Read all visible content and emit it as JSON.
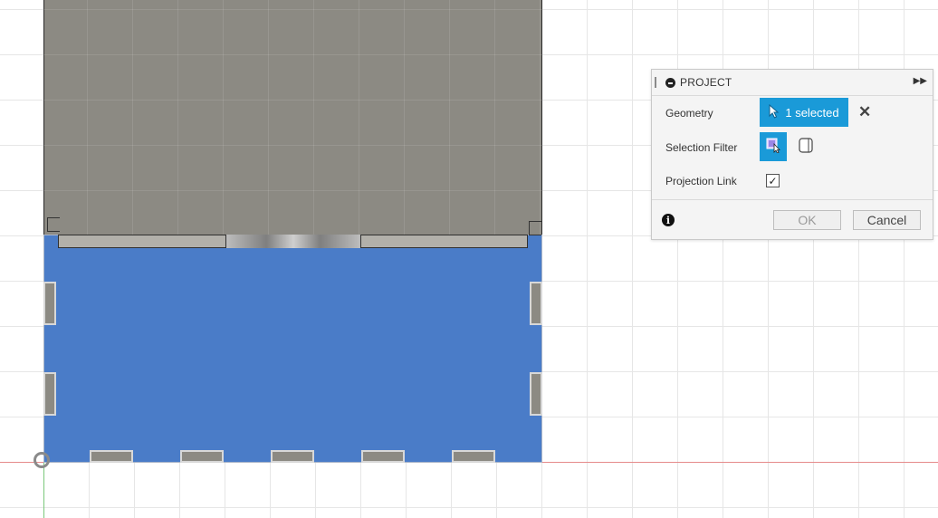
{
  "viewport": {
    "colors": {
      "grid": "#e6e6e6",
      "y_axis": "#7cc87c",
      "x_axis": "#e58a8a",
      "sketch_body": "#8c8a83",
      "selected_face": "#4a7cc8"
    },
    "origin_icon": "origin-circle-icon"
  },
  "panel": {
    "title": "PROJECT",
    "header_icon": "minus-circle-icon",
    "expand_icon": "double-chevron-right-icon",
    "geometry_label": "Geometry",
    "geometry_value": "1 selected",
    "geometry_icon": "cursor-arrow-icon",
    "clear_icon": "close-x-icon",
    "selection_filter_label": "Selection Filter",
    "filter_specified_icon": "face-select-icon",
    "filter_body_icon": "body-cylinder-icon",
    "projection_link_label": "Projection Link",
    "projection_link_checked": true,
    "checkmark": "✓",
    "info_icon": "info-icon",
    "info_glyph": "i",
    "ok_label": "OK",
    "cancel_label": "Cancel",
    "accent": "#1a9ad8"
  }
}
